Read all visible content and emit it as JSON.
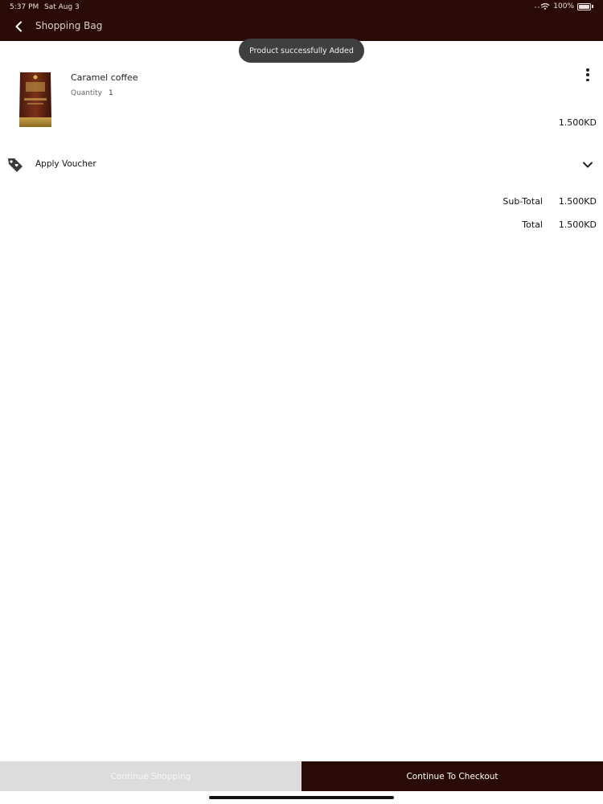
{
  "status_bar": {
    "time": "5:37 PM",
    "date": "Sat Aug 3",
    "battery": "100%"
  },
  "header": {
    "title": "Shopping Bag",
    "back_icon": "chevron-left-icon"
  },
  "toast": {
    "message": "Product successfully Added"
  },
  "cart": {
    "items": [
      {
        "name": "Caramel coffee",
        "quantity_label": "Quantity",
        "quantity": "1",
        "price": "1.500KD"
      }
    ]
  },
  "voucher": {
    "label": "Apply Voucher",
    "icon": "tag-icon"
  },
  "summary": {
    "subtotal_label": "Sub-Total",
    "subtotal_value": "1.500KD",
    "total_label": "Total",
    "total_value": "1.500KD"
  },
  "actions": {
    "continue_shopping": "Continue Shopping",
    "checkout": "Continue To Checkout"
  },
  "colors": {
    "brand": "#2a0a05",
    "toast": "#3f3f3f",
    "secondary_button": "#dcdcdc"
  }
}
